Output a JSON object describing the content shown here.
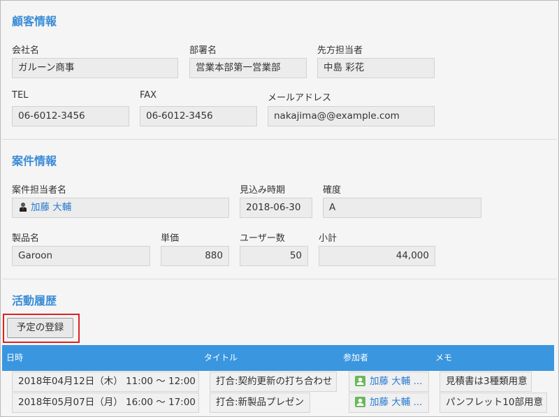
{
  "customer": {
    "section_title": "顧客情報",
    "company_label": "会社名",
    "company_value": "ガルーン商事",
    "dept_label": "部署名",
    "dept_value": "営業本部第一営業部",
    "contact_label": "先方担当者",
    "contact_value": "中島 彩花",
    "tel_label": "TEL",
    "tel_value": "06-6012-3456",
    "fax_label": "FAX",
    "fax_value": "06-6012-3456",
    "email_label": "メールアドレス",
    "email_value": "nakajima@@example.com"
  },
  "deal": {
    "section_title": "案件情報",
    "owner_label": "案件担当者名",
    "owner_value": "加藤 大輔",
    "forecast_label": "見込み時期",
    "forecast_value": "2018-06-30",
    "certainty_label": "確度",
    "certainty_value": "A",
    "product_label": "製品名",
    "product_value": "Garoon",
    "unit_price_label": "単価",
    "unit_price_value": "880",
    "users_label": "ユーザー数",
    "users_value": "50",
    "subtotal_label": "小計",
    "subtotal_value": "44,000"
  },
  "activity": {
    "section_title": "活動履歴",
    "register_button": "予定の登録",
    "columns": {
      "datetime": "日時",
      "title": "タイトル",
      "participants": "参加者",
      "memo": "メモ"
    },
    "rows": [
      {
        "datetime": "2018年04月12日（木） 11:00 ～ 12:00",
        "title": "打合:契約更新の打ち合わせ",
        "participant": "加藤 大輔 ...",
        "memo": "見積書は3種類用意"
      },
      {
        "datetime": "2018年05月07日（月） 16:00 ～ 17:00",
        "title": "打合:新製品プレゼン",
        "participant": "加藤 大輔 ...",
        "memo": "パンフレット10部用意"
      }
    ]
  },
  "colors": {
    "section_title": "#3a8cd6",
    "table_header": "#3a96df",
    "link": "#2a7bd0",
    "highlight_border": "#e02020"
  }
}
